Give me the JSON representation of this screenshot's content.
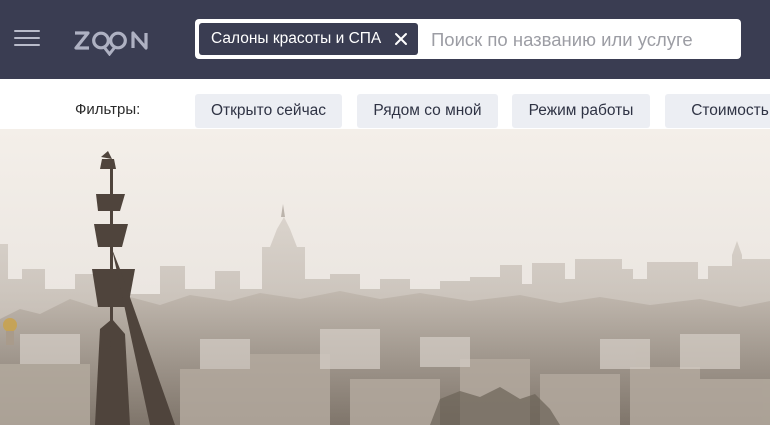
{
  "header": {
    "background": "#3a3d52",
    "logo_text": "ZOON",
    "search": {
      "category_chip": "Салоны красоты и СПА",
      "placeholder": "Поиск по названию или услуге"
    }
  },
  "filters": {
    "label": "Фильтры:",
    "items": [
      "Открыто сейчас",
      "Рядом со мной",
      "Режим работы",
      "Стоимость"
    ]
  },
  "icons": {
    "menu": "hamburger-icon",
    "chip_close": "close-icon"
  }
}
